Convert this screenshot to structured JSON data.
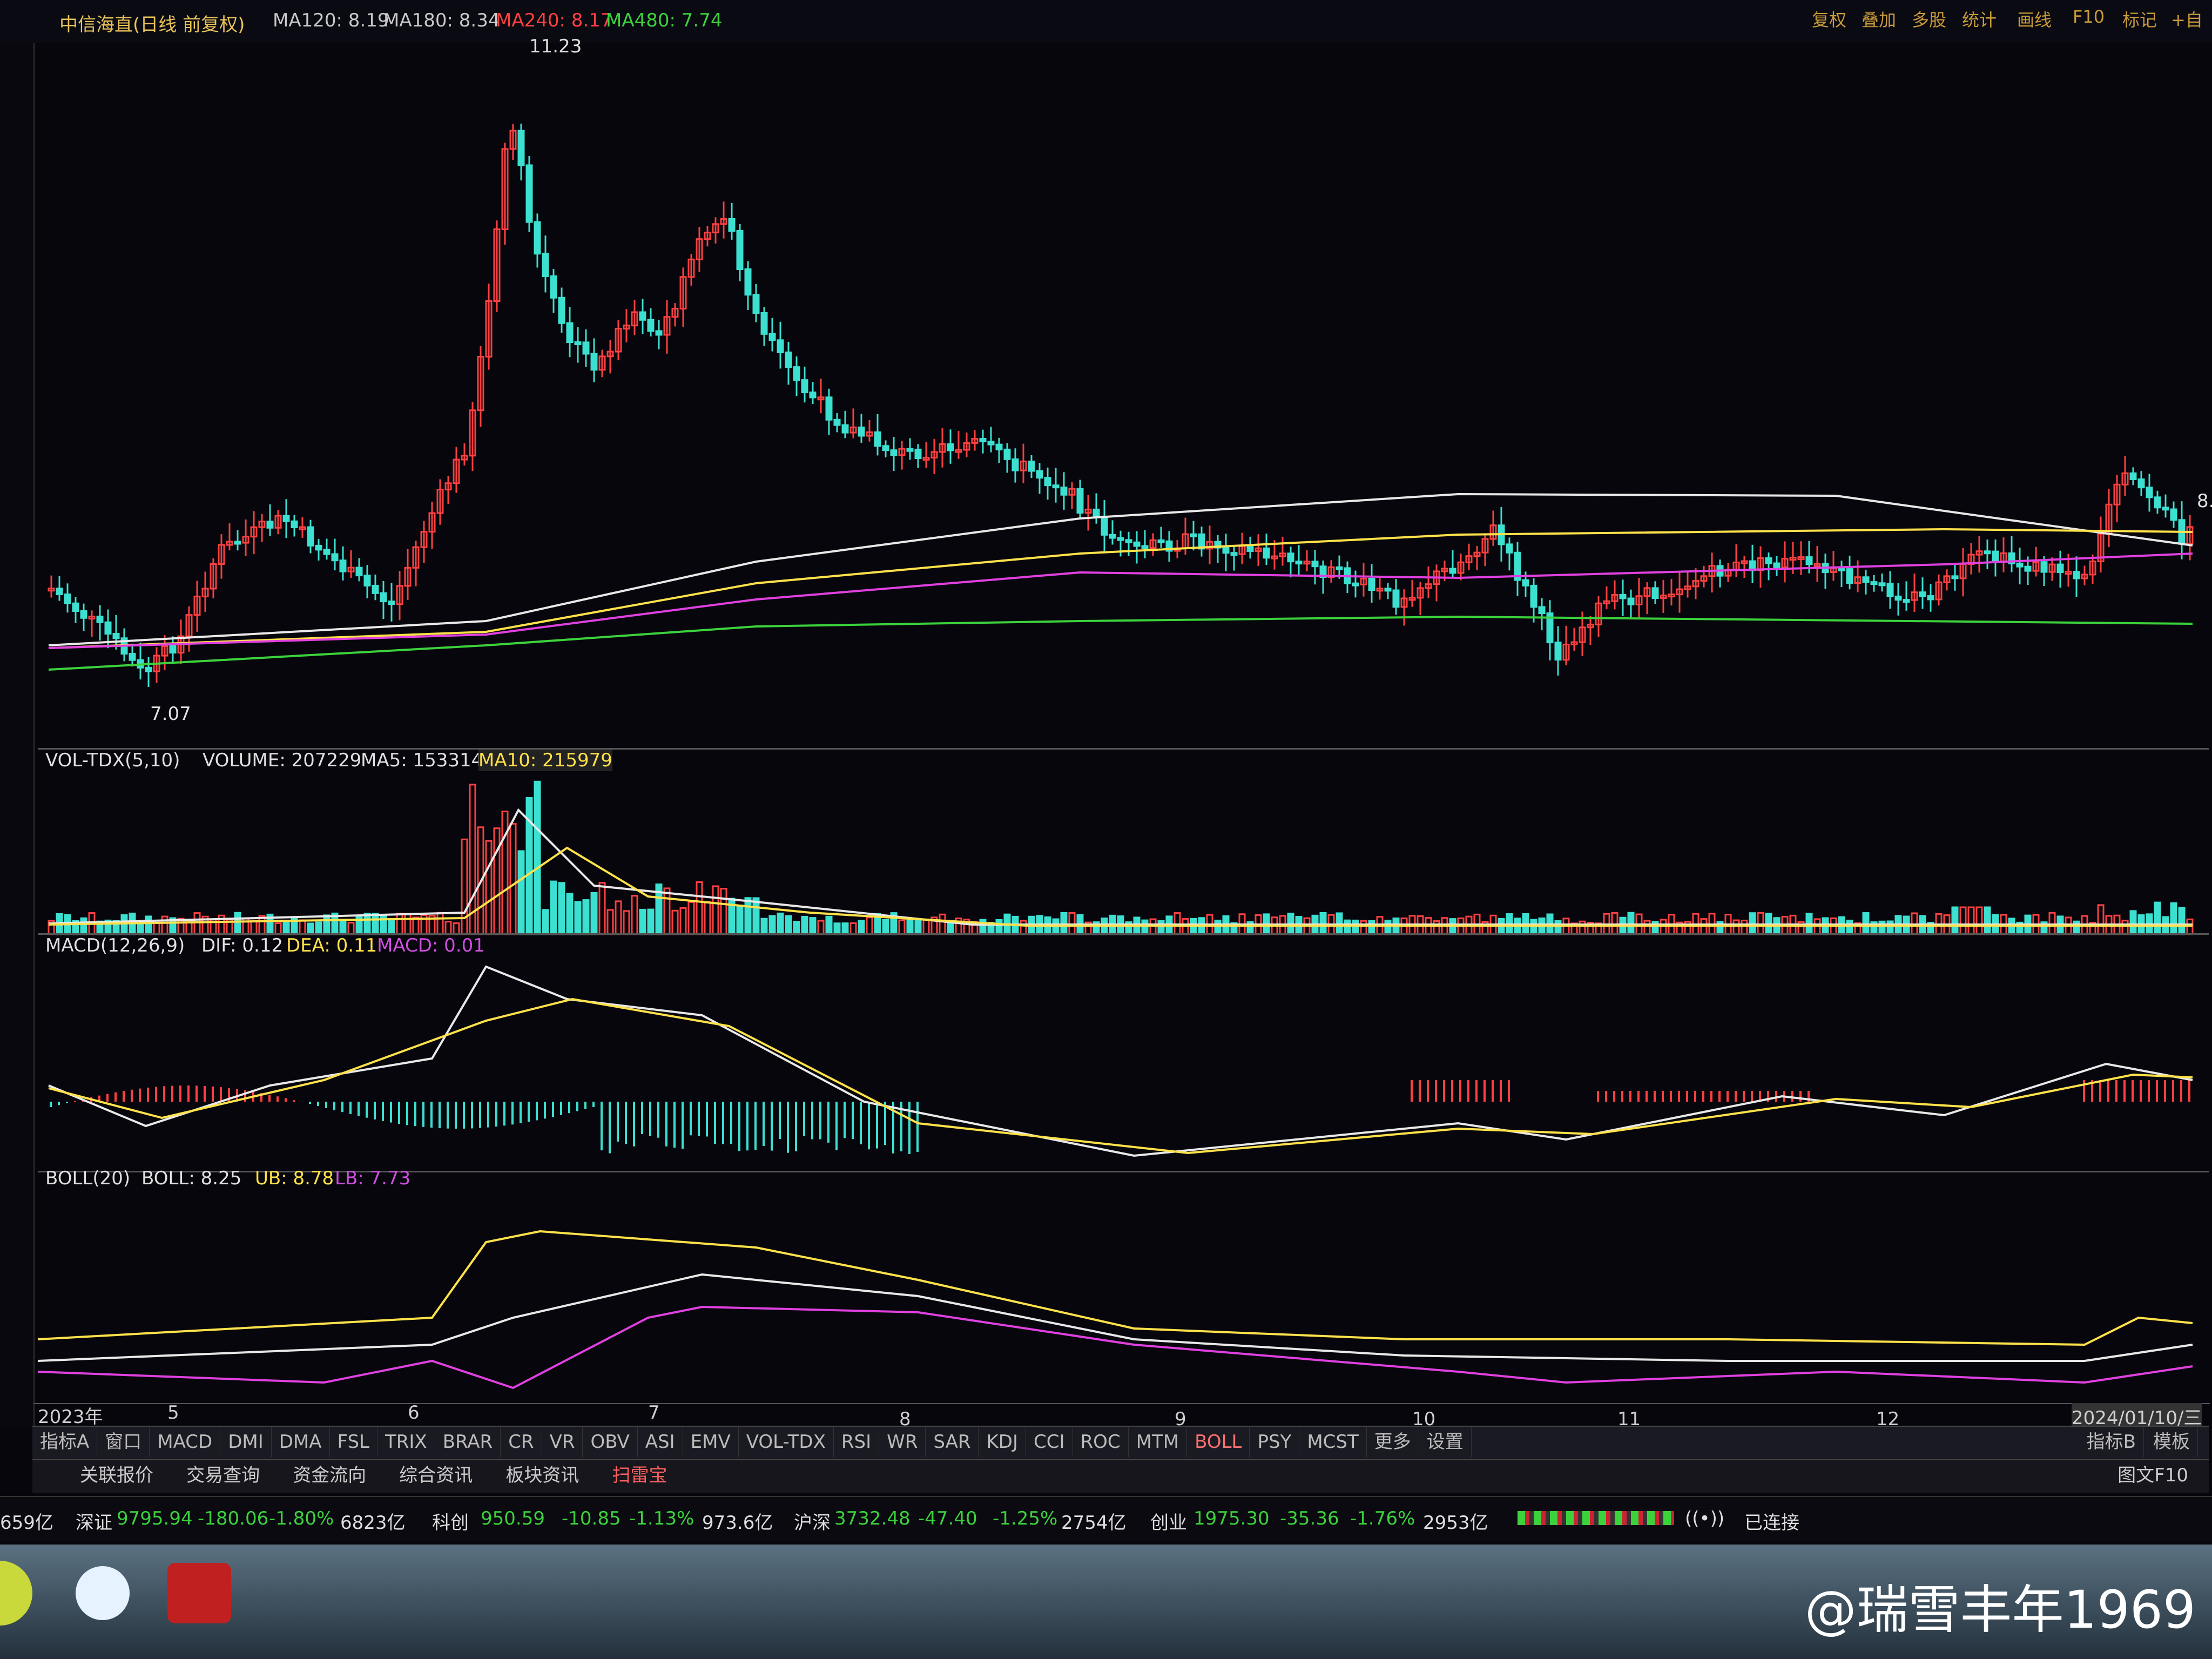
{
  "window": {
    "stock_title": "中信海直(日线 前复权)",
    "ma": [
      {
        "label": "MA120: 8.19",
        "color": "#e8e8e8"
      },
      {
        "label": "MA180: 8.34",
        "color": "#e8e8e8"
      },
      {
        "label": "MA240: 8.17",
        "color": "#ff4040"
      },
      {
        "label": "MA480: 7.74",
        "color": "#3cd23c"
      }
    ],
    "toolbar": [
      "复权",
      "叠加",
      "多股",
      "统计",
      "画线",
      "F10",
      "标记",
      "+自"
    ],
    "price_high_label": "11.23",
    "price_low_label": "7.07",
    "price_right_label": "8."
  },
  "volume_panel": {
    "name": "VOL-TDX(5,10)",
    "volume": "VOLUME: 207229",
    "ma5": "MA5: 153314",
    "ma10": "MA10: 215979"
  },
  "macd_panel": {
    "name": "MACD(12,26,9)",
    "dif": "DIF: 0.12",
    "dea": "DEA: 0.11",
    "macd": "MACD: 0.01"
  },
  "boll_panel": {
    "name": "BOLL(20)",
    "boll": "BOLL: 8.25",
    "ub": "UB: 8.78",
    "lb": "LB: 7.73"
  },
  "date_axis": [
    "2023年",
    "5",
    "6",
    "7",
    "8",
    "9",
    "10",
    "11",
    "12",
    "2024/01/10/三"
  ],
  "indicator_tabs": [
    "指标A",
    "窗口",
    "MACD",
    "DMI",
    "DMA",
    "FSL",
    "TRIX",
    "BRAR",
    "CR",
    "VR",
    "OBV",
    "ASI",
    "EMV",
    "VOL-TDX",
    "RSI",
    "WR",
    "SAR",
    "KDJ",
    "CCI",
    "ROC",
    "MTM",
    "BOLL",
    "PSY",
    "MCST",
    "更多",
    "设置"
  ],
  "active_tab": "BOLL",
  "right_tabs": [
    "指标B",
    "模板"
  ],
  "info_buttons": [
    "关联报价",
    "交易查询",
    "资金流向",
    "综合资讯",
    "板块资讯",
    "扫雷宝"
  ],
  "info_right": "图文F10",
  "status_bar": {
    "prefix": "659亿",
    "sz_name": "深证",
    "sz_value": "9795.94",
    "sz_change": "-180.06",
    "sz_pct": "-1.80%",
    "sz_amount": "6823亿",
    "kc_name": "科创",
    "kc_value": "950.59",
    "kc_change": "-10.85",
    "kc_pct": "-1.13%",
    "kc_amount": "973.6亿",
    "hs_name": "沪深",
    "hs_value": "3732.48",
    "hs_change": "-47.40",
    "hs_pct": "-1.25%",
    "hs_amount": "2754亿",
    "cy_name": "创业",
    "cy_value": "1975.30",
    "cy_change": "-35.36",
    "cy_pct": "-1.76%",
    "cy_amount": "2953亿",
    "connection": "已连接"
  },
  "watermark": "@瑞雪丰年1969",
  "colors": {
    "up": "#ff4040",
    "down": "#3ce0d0",
    "bg": "#06060c"
  }
}
